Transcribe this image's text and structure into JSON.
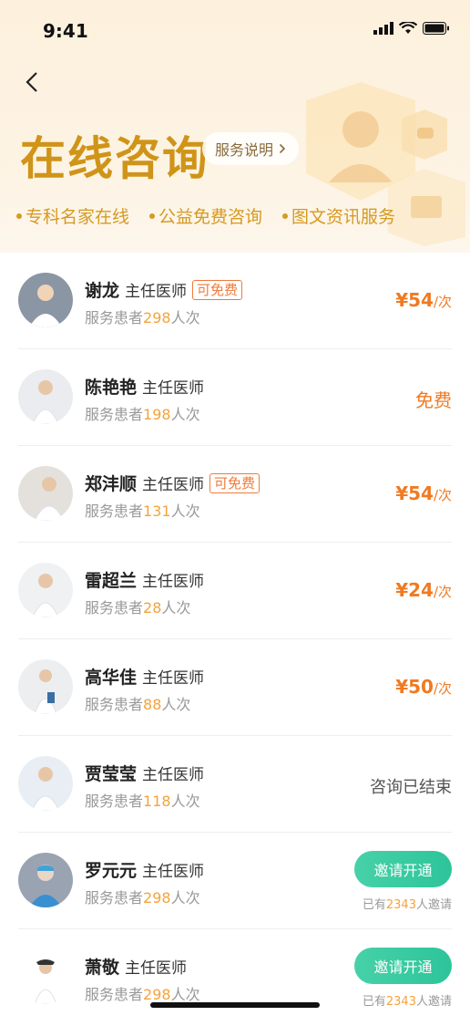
{
  "status": {
    "time": "9:41"
  },
  "header": {
    "title": "在线咨询",
    "service_button": "服务说明",
    "features": [
      "专科名家在线",
      "公益免费咨询",
      "图文资讯服务"
    ]
  },
  "doctors": [
    {
      "name": "谢龙",
      "rank": "主任医师",
      "tag": "可免费",
      "served_prefix": "服务患者",
      "served_num": "298",
      "served_suffix": "人次",
      "price": "¥54",
      "unit": "/次"
    },
    {
      "name": "陈艳艳",
      "rank": "主任医师",
      "served_prefix": "服务患者",
      "served_num": "198",
      "served_suffix": "人次",
      "status_text": "免费"
    },
    {
      "name": "郑沣顺",
      "rank": "主任医师",
      "tag": "可免费",
      "served_prefix": "服务患者",
      "served_num": "131",
      "served_suffix": "人次",
      "price": "¥54",
      "unit": "/次"
    },
    {
      "name": "雷超兰",
      "rank": "主任医师",
      "served_prefix": "服务患者",
      "served_num": "28",
      "served_suffix": "人次",
      "price": "¥24",
      "unit": "/次"
    },
    {
      "name": "高华佳",
      "rank": "主任医师",
      "served_prefix": "服务患者",
      "served_num": "88",
      "served_suffix": "人次",
      "price": "¥50",
      "unit": "/次"
    },
    {
      "name": "贾莹莹",
      "rank": "主任医师",
      "served_prefix": "服务患者",
      "served_num": "118",
      "served_suffix": "人次",
      "ended_text": "咨询已结束"
    },
    {
      "name": "罗元元",
      "rank": "主任医师",
      "served_prefix": "服务患者",
      "served_num": "298",
      "served_suffix": "人次",
      "invite_label": "邀请开通",
      "invite_prefix": "已有",
      "invite_num": "2343",
      "invite_suffix": "人邀请"
    },
    {
      "name": "萧敬",
      "rank": "主任医师",
      "served_prefix": "服务患者",
      "served_num": "298",
      "served_suffix": "人次",
      "invite_label": "邀请开通",
      "invite_prefix": "已有",
      "invite_num": "2343",
      "invite_suffix": "人邀请"
    }
  ],
  "colors": {
    "accent": "#cf9418",
    "price": "#f07a22",
    "invite": "#2dc49a"
  }
}
